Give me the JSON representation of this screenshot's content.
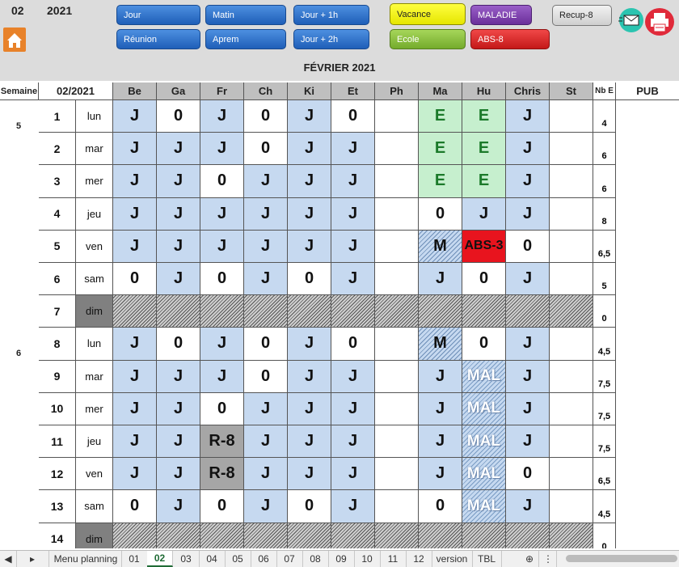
{
  "header": {
    "month_num": "02",
    "year": "2021",
    "month_title": "FÉVRIER 2021",
    "buttons": [
      {
        "label": "Jour"
      },
      {
        "label": "Matin"
      },
      {
        "label": "Jour + 1h"
      },
      {
        "label": "Réunion"
      },
      {
        "label": "Aprem"
      },
      {
        "label": "Jour + 2h"
      }
    ],
    "legend": [
      {
        "label": "Vacance"
      },
      {
        "label": "MALADIE"
      },
      {
        "label": "Recup-8"
      },
      {
        "label": "Ecole"
      },
      {
        "label": "ABS-8"
      }
    ],
    "icons": {
      "home": "home-icon",
      "mail": "mail-icon",
      "print": "printer-icon"
    }
  },
  "grid": {
    "semaine_label": "Semaine",
    "month_label": "02/2021",
    "nb_label": "Nb E",
    "right_label": "PUB",
    "columns": [
      "Be",
      "Ga",
      "Fr",
      "Ch",
      "Ki",
      "Et",
      "Ph",
      "Ma",
      "Hu",
      "Chris",
      "St"
    ],
    "weeks": [
      {
        "label": "5"
      },
      {
        "label": "6"
      }
    ],
    "rows": [
      {
        "num": "1",
        "day": "lun",
        "nb": "4",
        "cells": [
          "J",
          "0",
          "J",
          "0",
          "J",
          "0",
          "",
          "E",
          "E",
          "J",
          ""
        ]
      },
      {
        "num": "2",
        "day": "mar",
        "nb": "6",
        "cells": [
          "J",
          "J",
          "J",
          "0",
          "J",
          "J",
          "",
          "E",
          "E",
          "J",
          ""
        ]
      },
      {
        "num": "3",
        "day": "mer",
        "nb": "6",
        "cells": [
          "J",
          "J",
          "0",
          "J",
          "J",
          "J",
          "",
          "E",
          "E",
          "J",
          ""
        ]
      },
      {
        "num": "4",
        "day": "jeu",
        "nb": "8",
        "cells": [
          "J",
          "J",
          "J",
          "J",
          "J",
          "J",
          "",
          "0",
          "J",
          "J",
          ""
        ]
      },
      {
        "num": "5",
        "day": "ven",
        "nb": "6,5",
        "cells": [
          "J",
          "J",
          "J",
          "J",
          "J",
          "J",
          "",
          "M",
          "ABS-3",
          "0",
          ""
        ]
      },
      {
        "num": "6",
        "day": "sam",
        "nb": "5",
        "cells": [
          "0",
          "J",
          "0",
          "J",
          "0",
          "J",
          "",
          "J",
          "0",
          "J",
          ""
        ]
      },
      {
        "num": "7",
        "day": "dim",
        "nb": "0",
        "cells": [
          "",
          "",
          "",
          "",
          "",
          "",
          "",
          "",
          "",
          "",
          ""
        ]
      },
      {
        "num": "8",
        "day": "lun",
        "nb": "4,5",
        "cells": [
          "J",
          "0",
          "J",
          "0",
          "J",
          "0",
          "",
          "M",
          "0",
          "J",
          ""
        ]
      },
      {
        "num": "9",
        "day": "mar",
        "nb": "7,5",
        "cells": [
          "J",
          "J",
          "J",
          "0",
          "J",
          "J",
          "",
          "J",
          "MAL",
          "J",
          ""
        ]
      },
      {
        "num": "10",
        "day": "mer",
        "nb": "7,5",
        "cells": [
          "J",
          "J",
          "0",
          "J",
          "J",
          "J",
          "",
          "J",
          "MAL",
          "J",
          ""
        ]
      },
      {
        "num": "11",
        "day": "jeu",
        "nb": "7,5",
        "cells": [
          "J",
          "J",
          "R-8",
          "J",
          "J",
          "J",
          "",
          "J",
          "MAL",
          "J",
          ""
        ]
      },
      {
        "num": "12",
        "day": "ven",
        "nb": "6,5",
        "cells": [
          "J",
          "J",
          "R-8",
          "J",
          "J",
          "J",
          "",
          "J",
          "MAL",
          "0",
          ""
        ]
      },
      {
        "num": "13",
        "day": "sam",
        "nb": "4,5",
        "cells": [
          "0",
          "J",
          "0",
          "J",
          "0",
          "J",
          "",
          "0",
          "MAL",
          "J",
          ""
        ]
      },
      {
        "num": "14",
        "day": "dim",
        "nb": "0",
        "cells": [
          "",
          "",
          "",
          "",
          "",
          "",
          "",
          "",
          "",
          "",
          ""
        ]
      }
    ]
  },
  "tabs": [
    "Menu planning",
    "01",
    "02",
    "03",
    "04",
    "05",
    "06",
    "07",
    "08",
    "09",
    "10",
    "11",
    "12",
    "version",
    "TBL"
  ],
  "active_tab": "02",
  "colors": {
    "blue_cell": "#c6d9f0",
    "green_cell": "#c6efce",
    "red_cell": "#e8141e",
    "grey_cell": "#a6a6a6"
  }
}
